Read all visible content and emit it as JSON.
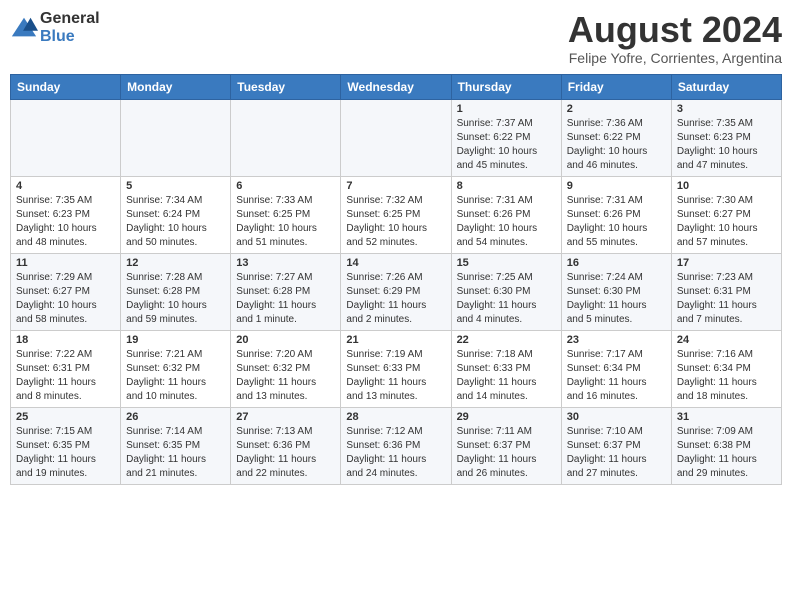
{
  "logo": {
    "general": "General",
    "blue": "Blue"
  },
  "title": "August 2024",
  "location": "Felipe Yofre, Corrientes, Argentina",
  "days_of_week": [
    "Sunday",
    "Monday",
    "Tuesday",
    "Wednesday",
    "Thursday",
    "Friday",
    "Saturday"
  ],
  "weeks": [
    [
      {
        "day": "",
        "info": ""
      },
      {
        "day": "",
        "info": ""
      },
      {
        "day": "",
        "info": ""
      },
      {
        "day": "",
        "info": ""
      },
      {
        "day": "1",
        "info": "Sunrise: 7:37 AM\nSunset: 6:22 PM\nDaylight: 10 hours and 45 minutes."
      },
      {
        "day": "2",
        "info": "Sunrise: 7:36 AM\nSunset: 6:22 PM\nDaylight: 10 hours and 46 minutes."
      },
      {
        "day": "3",
        "info": "Sunrise: 7:35 AM\nSunset: 6:23 PM\nDaylight: 10 hours and 47 minutes."
      }
    ],
    [
      {
        "day": "4",
        "info": "Sunrise: 7:35 AM\nSunset: 6:23 PM\nDaylight: 10 hours and 48 minutes."
      },
      {
        "day": "5",
        "info": "Sunrise: 7:34 AM\nSunset: 6:24 PM\nDaylight: 10 hours and 50 minutes."
      },
      {
        "day": "6",
        "info": "Sunrise: 7:33 AM\nSunset: 6:25 PM\nDaylight: 10 hours and 51 minutes."
      },
      {
        "day": "7",
        "info": "Sunrise: 7:32 AM\nSunset: 6:25 PM\nDaylight: 10 hours and 52 minutes."
      },
      {
        "day": "8",
        "info": "Sunrise: 7:31 AM\nSunset: 6:26 PM\nDaylight: 10 hours and 54 minutes."
      },
      {
        "day": "9",
        "info": "Sunrise: 7:31 AM\nSunset: 6:26 PM\nDaylight: 10 hours and 55 minutes."
      },
      {
        "day": "10",
        "info": "Sunrise: 7:30 AM\nSunset: 6:27 PM\nDaylight: 10 hours and 57 minutes."
      }
    ],
    [
      {
        "day": "11",
        "info": "Sunrise: 7:29 AM\nSunset: 6:27 PM\nDaylight: 10 hours and 58 minutes."
      },
      {
        "day": "12",
        "info": "Sunrise: 7:28 AM\nSunset: 6:28 PM\nDaylight: 10 hours and 59 minutes."
      },
      {
        "day": "13",
        "info": "Sunrise: 7:27 AM\nSunset: 6:28 PM\nDaylight: 11 hours and 1 minute."
      },
      {
        "day": "14",
        "info": "Sunrise: 7:26 AM\nSunset: 6:29 PM\nDaylight: 11 hours and 2 minutes."
      },
      {
        "day": "15",
        "info": "Sunrise: 7:25 AM\nSunset: 6:30 PM\nDaylight: 11 hours and 4 minutes."
      },
      {
        "day": "16",
        "info": "Sunrise: 7:24 AM\nSunset: 6:30 PM\nDaylight: 11 hours and 5 minutes."
      },
      {
        "day": "17",
        "info": "Sunrise: 7:23 AM\nSunset: 6:31 PM\nDaylight: 11 hours and 7 minutes."
      }
    ],
    [
      {
        "day": "18",
        "info": "Sunrise: 7:22 AM\nSunset: 6:31 PM\nDaylight: 11 hours and 8 minutes."
      },
      {
        "day": "19",
        "info": "Sunrise: 7:21 AM\nSunset: 6:32 PM\nDaylight: 11 hours and 10 minutes."
      },
      {
        "day": "20",
        "info": "Sunrise: 7:20 AM\nSunset: 6:32 PM\nDaylight: 11 hours and 13 minutes."
      },
      {
        "day": "21",
        "info": "Sunrise: 7:19 AM\nSunset: 6:33 PM\nDaylight: 11 hours and 13 minutes."
      },
      {
        "day": "22",
        "info": "Sunrise: 7:18 AM\nSunset: 6:33 PM\nDaylight: 11 hours and 14 minutes."
      },
      {
        "day": "23",
        "info": "Sunrise: 7:17 AM\nSunset: 6:34 PM\nDaylight: 11 hours and 16 minutes."
      },
      {
        "day": "24",
        "info": "Sunrise: 7:16 AM\nSunset: 6:34 PM\nDaylight: 11 hours and 18 minutes."
      }
    ],
    [
      {
        "day": "25",
        "info": "Sunrise: 7:15 AM\nSunset: 6:35 PM\nDaylight: 11 hours and 19 minutes."
      },
      {
        "day": "26",
        "info": "Sunrise: 7:14 AM\nSunset: 6:35 PM\nDaylight: 11 hours and 21 minutes."
      },
      {
        "day": "27",
        "info": "Sunrise: 7:13 AM\nSunset: 6:36 PM\nDaylight: 11 hours and 22 minutes."
      },
      {
        "day": "28",
        "info": "Sunrise: 7:12 AM\nSunset: 6:36 PM\nDaylight: 11 hours and 24 minutes."
      },
      {
        "day": "29",
        "info": "Sunrise: 7:11 AM\nSunset: 6:37 PM\nDaylight: 11 hours and 26 minutes."
      },
      {
        "day": "30",
        "info": "Sunrise: 7:10 AM\nSunset: 6:37 PM\nDaylight: 11 hours and 27 minutes."
      },
      {
        "day": "31",
        "info": "Sunrise: 7:09 AM\nSunset: 6:38 PM\nDaylight: 11 hours and 29 minutes."
      }
    ]
  ]
}
